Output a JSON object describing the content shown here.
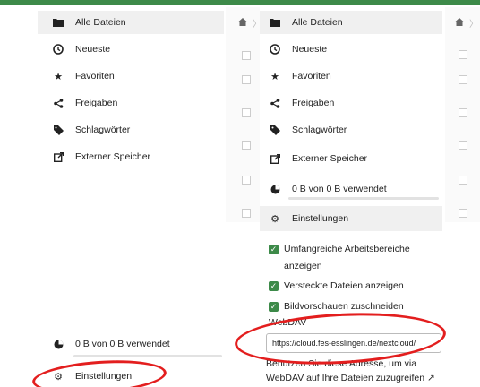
{
  "colors": {
    "header_green": "#3d8a49",
    "active_bg": "#f0f0f0",
    "checkbox_green": "#3d8a49",
    "annotation_red": "#e31e1e"
  },
  "left_nav": {
    "items": [
      {
        "icon": "folder-icon",
        "label": "Alle Dateien"
      },
      {
        "icon": "clock-icon",
        "label": "Neueste"
      },
      {
        "icon": "star-icon",
        "label": "Favoriten"
      },
      {
        "icon": "share-icon",
        "label": "Freigaben"
      },
      {
        "icon": "tag-icon",
        "label": "Schlagwörter"
      },
      {
        "icon": "external-storage-icon",
        "label": "Externer Speicher"
      }
    ],
    "quota": "0 B von 0 B verwendet",
    "settings": "Einstellungen"
  },
  "right_nav": {
    "items": [
      {
        "icon": "folder-icon",
        "label": "Alle Dateien"
      },
      {
        "icon": "clock-icon",
        "label": "Neueste"
      },
      {
        "icon": "star-icon",
        "label": "Favoriten"
      },
      {
        "icon": "share-icon",
        "label": "Freigaben"
      },
      {
        "icon": "tag-icon",
        "label": "Schlagwörter"
      },
      {
        "icon": "external-storage-icon",
        "label": "Externer Speicher"
      }
    ],
    "quota": "0 B von 0 B verwendet",
    "settings": "Einstellungen"
  },
  "settings_panel": {
    "options": [
      {
        "label": "Umfangreiche Arbeitsbereiche anzeigen",
        "checked": true
      },
      {
        "label": "Versteckte Dateien anzeigen",
        "checked": true
      },
      {
        "label": "Bildvorschauen zuschneiden",
        "checked": true
      }
    ],
    "webdav_title": "WebDAV",
    "webdav_url": "https://cloud.fes-esslingen.de/nextcloud/",
    "webdav_hint_line1": "Benutzen Sie diese Adresse, um via",
    "webdav_hint_line2": "WebDAV auf Ihre Dateien zuzugreifen ↗"
  }
}
